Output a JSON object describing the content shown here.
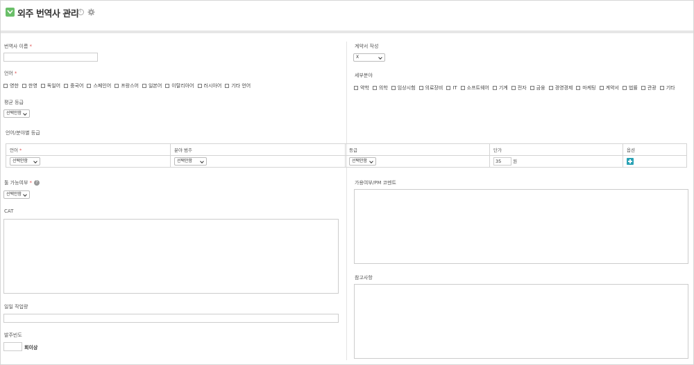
{
  "header": {
    "title": "외주 번역사 관리"
  },
  "form": {
    "translator_name": {
      "label": "번역사 이름",
      "req": "*",
      "value": ""
    },
    "contract": {
      "label": "계약서 작성",
      "value": "X"
    },
    "language": {
      "label": "언어",
      "req": "*",
      "options": [
        "영한",
        "한영",
        "독일어",
        "중국어",
        "스페인어",
        "프랑스어",
        "일본어",
        "이탈리아어",
        "러시아어",
        "기타 언어"
      ]
    },
    "field": {
      "label": "세부분야",
      "options": [
        "약학",
        "의학",
        "임상시험",
        "의료장비",
        "IT",
        "소프트웨어",
        "기계",
        "전자",
        "금융",
        "경영경제",
        "마케팅",
        "계약서",
        "법률",
        "관광",
        "기타"
      ]
    },
    "avg_grade": {
      "label": "평균 등급",
      "value": "선택안함"
    },
    "lang_grade": {
      "label": "언어/분야별 등급"
    },
    "table": {
      "headers": {
        "lang": "언어",
        "lang_req": "*",
        "field": "분야 범주",
        "grade": "등급",
        "price": "단가",
        "option": "옵션"
      },
      "row": {
        "lang": "선택안함",
        "field": "선택안함",
        "grade": "선택안함",
        "price": "35",
        "unit": "원"
      }
    },
    "tool": {
      "label": "툴 가능여부",
      "req": "*",
      "help": "?",
      "value": "선택안함"
    },
    "availability": {
      "label": "가용여부/PM 코멘트"
    },
    "cat": {
      "label": "CAT"
    },
    "notes": {
      "label": "참고사항"
    },
    "daily": {
      "label": "일일 작업량"
    },
    "frequency": {
      "label": "발주빈도",
      "unit": "회이상"
    }
  }
}
